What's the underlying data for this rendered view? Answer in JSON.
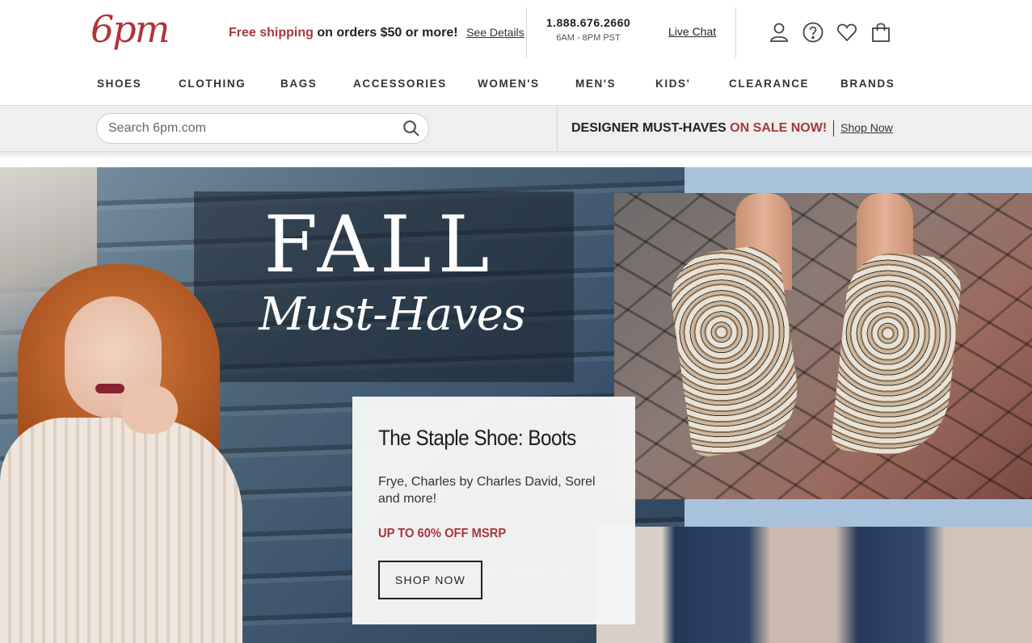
{
  "brand": {
    "logo_text": "6pm",
    "accent_color": "#a8373c"
  },
  "promo": {
    "free_shipping": "Free shipping",
    "rest": " on orders $50 or more!",
    "details_link": "See Details"
  },
  "contact": {
    "phone": "1.888.676.2660",
    "hours": "6AM - 8PM PST",
    "live_chat": "Live Chat"
  },
  "header_icons": [
    "account-icon",
    "help-icon",
    "heart-icon",
    "shopping-bag-icon"
  ],
  "nav": {
    "items": [
      "SHOES",
      "CLOTHING",
      "BAGS",
      "ACCESSORIES",
      "WOMEN'S",
      "MEN'S",
      "KIDS'",
      "CLEARANCE",
      "BRANDS"
    ]
  },
  "search": {
    "placeholder": "Search 6pm.com",
    "value": ""
  },
  "banner_strip": {
    "lead": "DESIGNER MUST-HAVES ",
    "sale": "ON SALE NOW!",
    "link": "Shop Now"
  },
  "hero": {
    "headline": "FALL",
    "script": "Must-Haves",
    "card": {
      "title": "The Staple Shoe: Boots",
      "description": "Frye, Charles by Charles David, Sorel and more!",
      "sale": "UP TO 60% OFF MSRP",
      "cta": "SHOP NOW"
    }
  }
}
